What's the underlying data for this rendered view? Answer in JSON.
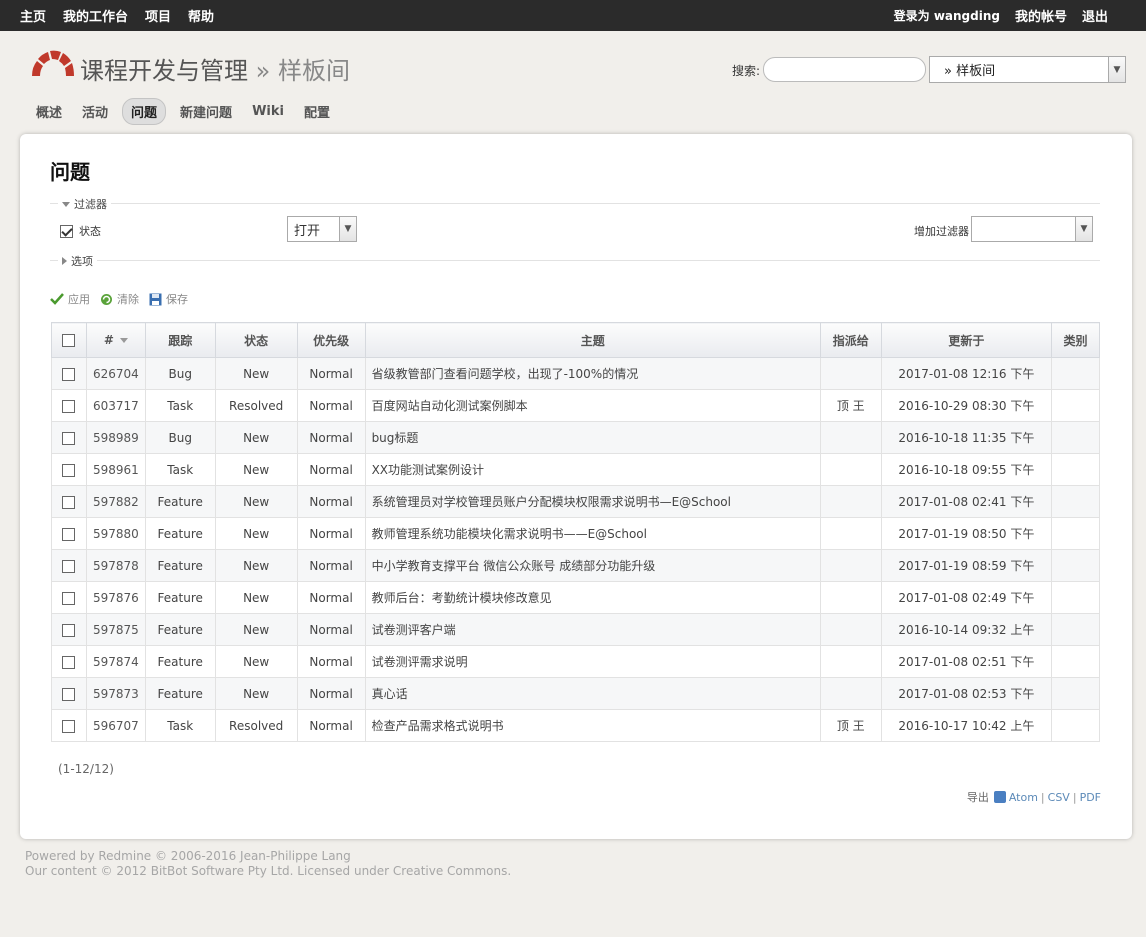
{
  "topbar": {
    "left": [
      "主页",
      "我的工作台",
      "项目",
      "帮助"
    ],
    "logged_as_prefix": "登录为 ",
    "user": "wangding",
    "my_account": "我的帐号",
    "logout": "退出"
  },
  "header": {
    "project": "课程开发与管理",
    "separator": "»",
    "subproject": "样板间",
    "search_label": "搜索:",
    "search_value": "",
    "jump_value": "» 样板间"
  },
  "menu": {
    "items": [
      "概述",
      "活动",
      "问题",
      "新建问题",
      "Wiki",
      "配置"
    ],
    "selected": "问题"
  },
  "page": {
    "title": "问题",
    "filters_legend": "过滤器",
    "status_label": "状态",
    "status_operator": "打开",
    "add_filter_label": "增加过滤器",
    "options_legend": "选项",
    "apply": "应用",
    "clear": "清除",
    "save": "保存"
  },
  "table": {
    "headers": [
      "#",
      "跟踪",
      "状态",
      "优先级",
      "主题",
      "指派给",
      "更新于",
      "类别"
    ],
    "rows": [
      {
        "id": "626704",
        "tracker": "Bug",
        "status": "New",
        "priority": "Normal",
        "subject": "省级教管部门查看问题学校，出现了-100%的情况",
        "assignee": "",
        "updated": "2017-01-08 12:16 下午",
        "category": ""
      },
      {
        "id": "603717",
        "tracker": "Task",
        "status": "Resolved",
        "priority": "Normal",
        "subject": "百度网站自动化测试案例脚本",
        "assignee": "顶 王",
        "updated": "2016-10-29 08:30 下午",
        "category": ""
      },
      {
        "id": "598989",
        "tracker": "Bug",
        "status": "New",
        "priority": "Normal",
        "subject": "bug标题",
        "assignee": "",
        "updated": "2016-10-18 11:35 下午",
        "category": ""
      },
      {
        "id": "598961",
        "tracker": "Task",
        "status": "New",
        "priority": "Normal",
        "subject": "XX功能测试案例设计",
        "assignee": "",
        "updated": "2016-10-18 09:55 下午",
        "category": ""
      },
      {
        "id": "597882",
        "tracker": "Feature",
        "status": "New",
        "priority": "Normal",
        "subject": "系统管理员对学校管理员账户分配模块权限需求说明书—E@School",
        "assignee": "",
        "updated": "2017-01-08 02:41 下午",
        "category": ""
      },
      {
        "id": "597880",
        "tracker": "Feature",
        "status": "New",
        "priority": "Normal",
        "subject": "教师管理系统功能模块化需求说明书——E@School",
        "assignee": "",
        "updated": "2017-01-19 08:50 下午",
        "category": ""
      },
      {
        "id": "597878",
        "tracker": "Feature",
        "status": "New",
        "priority": "Normal",
        "subject": "中小学教育支撑平台 微信公众账号 成绩部分功能升级",
        "assignee": "",
        "updated": "2017-01-19 08:59 下午",
        "category": ""
      },
      {
        "id": "597876",
        "tracker": "Feature",
        "status": "New",
        "priority": "Normal",
        "subject": "教师后台：考勤统计模块修改意见",
        "assignee": "",
        "updated": "2017-01-08 02:49 下午",
        "category": ""
      },
      {
        "id": "597875",
        "tracker": "Feature",
        "status": "New",
        "priority": "Normal",
        "subject": "试卷测评客户端",
        "assignee": "",
        "updated": "2016-10-14 09:32 上午",
        "category": ""
      },
      {
        "id": "597874",
        "tracker": "Feature",
        "status": "New",
        "priority": "Normal",
        "subject": "试卷测评需求说明",
        "assignee": "",
        "updated": "2017-01-08 02:51 下午",
        "category": ""
      },
      {
        "id": "597873",
        "tracker": "Feature",
        "status": "New",
        "priority": "Normal",
        "subject": "真心话",
        "assignee": "",
        "updated": "2017-01-08 02:53 下午",
        "category": ""
      },
      {
        "id": "596707",
        "tracker": "Task",
        "status": "Resolved",
        "priority": "Normal",
        "subject": "检查产品需求格式说明书",
        "assignee": "顶 王",
        "updated": "2016-10-17 10:42 上午",
        "category": ""
      }
    ]
  },
  "pagination": "(1-12/12)",
  "export": {
    "label": "导出",
    "formats": [
      "Atom",
      "CSV",
      "PDF"
    ]
  },
  "footer": {
    "line1": "Powered by Redmine © 2006-2016 Jean-Philippe Lang",
    "line2": "Our content © 2012 BitBot Software Pty Ltd. Licensed under Creative Commons."
  },
  "colors": {
    "topbar": "#2b2b2b",
    "background": "#f1efeb",
    "logo": "#c0392b",
    "link": "#5c8ab8"
  }
}
